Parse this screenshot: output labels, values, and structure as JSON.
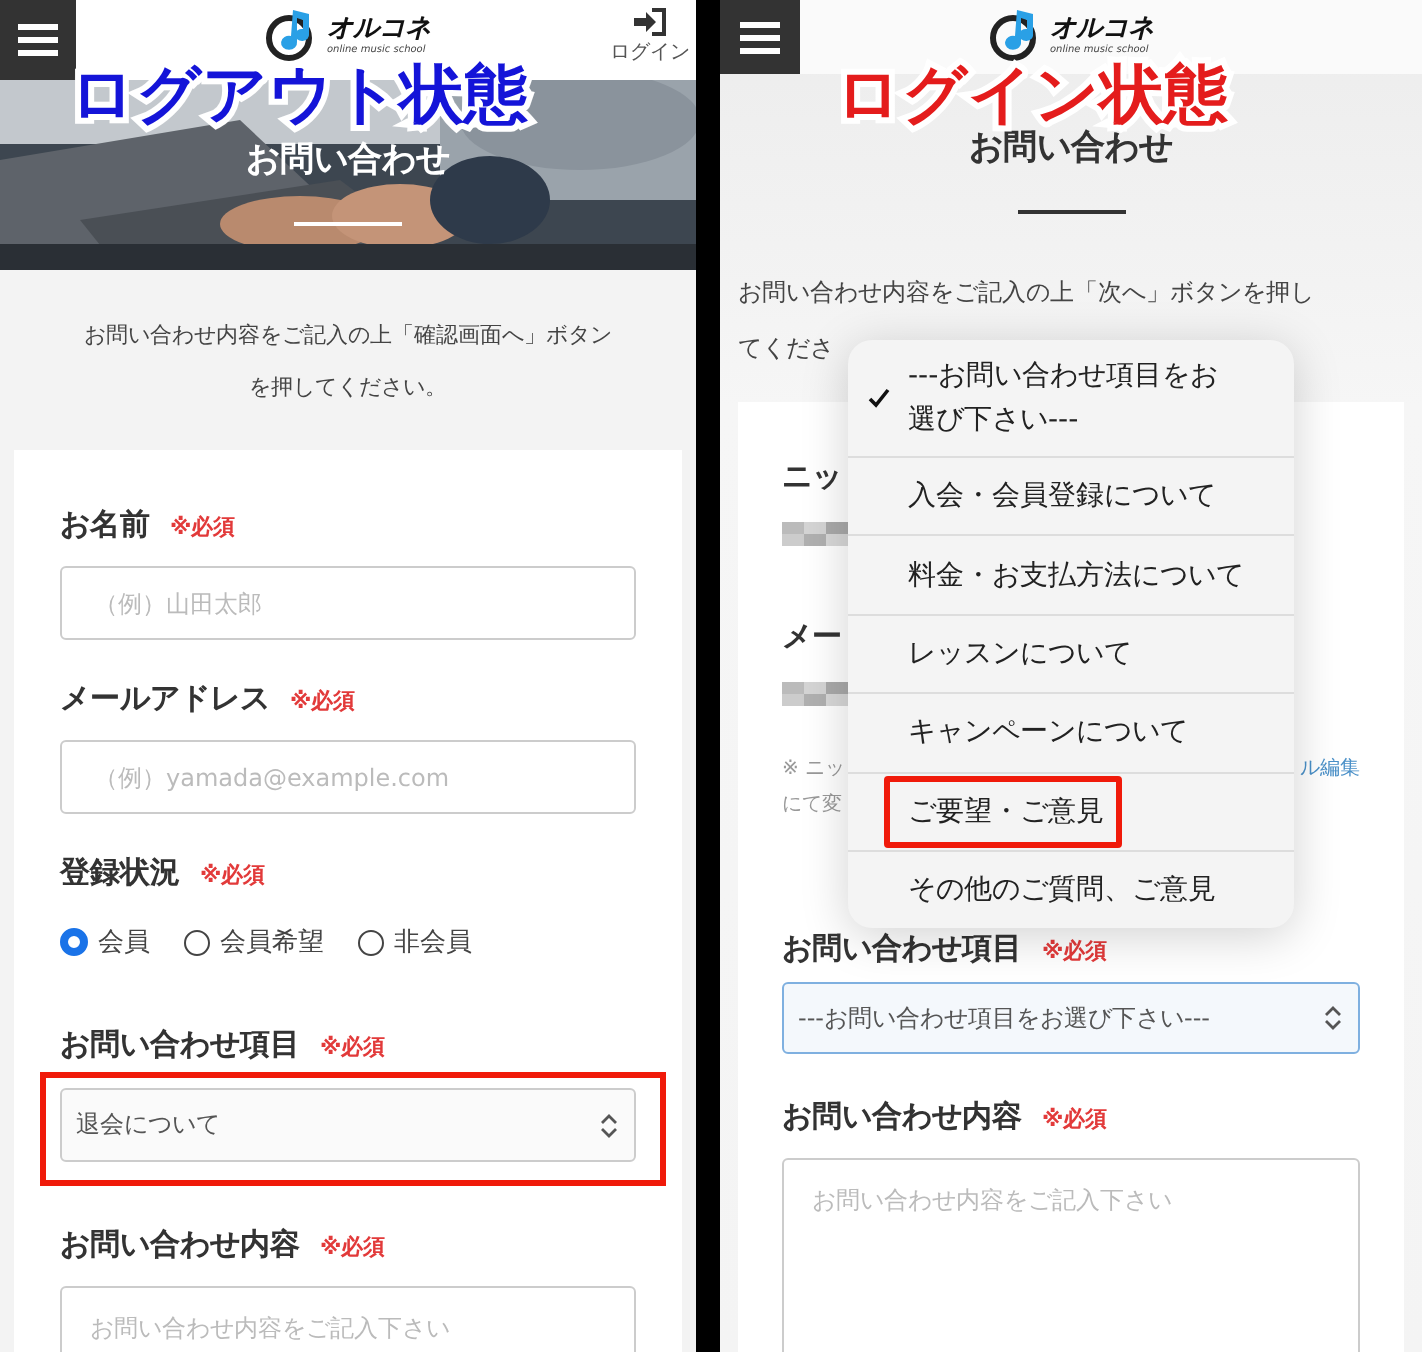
{
  "panels": [
    {
      "kind": "logged_out",
      "annotation": "ログアウト状態",
      "header": {
        "logo": "オルコネ",
        "logo_tagline": "online music school",
        "login_label": "ログイン"
      },
      "hero": {
        "kind": "picture",
        "title": "お問い合わせ"
      },
      "intro": [
        "お問い合わせ内容をご記入の上「確認画面へ」ボタン",
        "を押してください。"
      ],
      "fields": [
        {
          "kind": "text",
          "label": "お名前",
          "required": "※必須",
          "placeholder": "（例）山田太郎"
        },
        {
          "kind": "text",
          "label": "メールアドレス",
          "required": "※必須",
          "placeholder": "（例）yamada@example.com"
        },
        {
          "kind": "radio",
          "label": "登録状況",
          "required": "※必須",
          "options": [
            {
              "label": "会員",
              "selected": true
            },
            {
              "label": "会員希望",
              "selected": false
            },
            {
              "label": "非会員",
              "selected": false
            }
          ]
        },
        {
          "kind": "select",
          "label": "お問い合わせ項目",
          "required": "※必須",
          "value": "退会について",
          "annotated": true,
          "focused": false
        },
        {
          "kind": "textarea",
          "label": "お問い合わせ内容",
          "required": "※必須",
          "placeholder": "お問い合わせ内容をご記入下さい"
        }
      ]
    },
    {
      "kind": "logged_in",
      "annotation": "ログイン状態",
      "header": {
        "logo": "オルコネ",
        "logo_tagline": "online music school"
      },
      "hero": {
        "kind": "plain",
        "title": "お問い合わせ"
      },
      "intro": [
        "お問い合わせ内容をご記入の上「次へ」ボタンを押し",
        "てくださ"
      ],
      "fields": [
        {
          "kind": "readonly",
          "label": "ニッ",
          "value_redacted": true
        },
        {
          "kind": "readonly",
          "label": "メー",
          "value_redacted": true
        },
        {
          "kind": "note",
          "lines": [
            "※ ニッ",
            "にて変"
          ],
          "link": "ル編集"
        },
        {
          "kind": "select",
          "label": "お問い合わせ項目",
          "required": "※必須",
          "value": "---お問い合わせ項目をお選び下さい---",
          "annotated": false,
          "focused": true
        },
        {
          "kind": "textarea",
          "label": "お問い合わせ内容",
          "required": "※必須",
          "placeholder": "お問い合わせ内容をご記入下さい"
        }
      ],
      "dropdown": {
        "options": [
          {
            "label": "---お問い合わせ項目をお選び下さい---",
            "selected": true,
            "annotated": false
          },
          {
            "label": "入会・会員登録について",
            "selected": false,
            "annotated": false
          },
          {
            "label": "料金・お支払方法について",
            "selected": false,
            "annotated": false
          },
          {
            "label": "レッスンについて",
            "selected": false,
            "annotated": false
          },
          {
            "label": "キャンペーンについて",
            "selected": false,
            "annotated": false
          },
          {
            "label": "ご要望・ご意見",
            "selected": false,
            "annotated": true
          },
          {
            "label": "その他のご質問、ご意見",
            "selected": false,
            "annotated": false
          }
        ]
      }
    }
  ]
}
